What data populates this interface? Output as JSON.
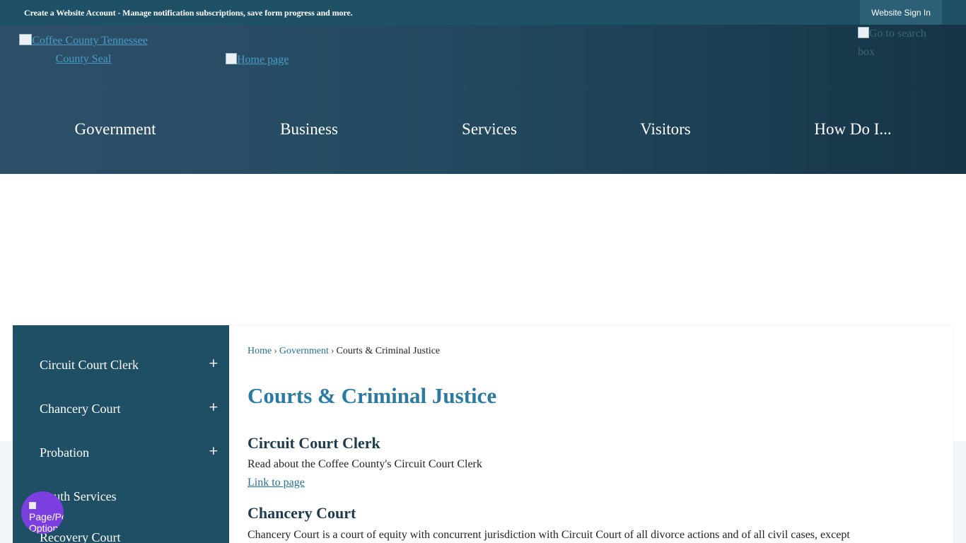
{
  "topbar": {
    "message_bold": "Create a Website Account",
    "message_rest": " - Manage notification subscriptions, save form progress and more.",
    "signin_label": "Website Sign In"
  },
  "header": {
    "seal_alt": "Coffee County Tennessee County Seal",
    "home_alt": "Home page",
    "search_alt": "Go to search box"
  },
  "nav": {
    "items": [
      "Government",
      "Business",
      "Services",
      "Visitors",
      "How Do I..."
    ]
  },
  "sidebar": {
    "items": [
      {
        "label": "Circuit Court Clerk",
        "expand": "+"
      },
      {
        "label": "Chancery Court",
        "expand": "+"
      },
      {
        "label": "Probation",
        "expand": "+"
      },
      {
        "label": "Youth Services",
        "expand": ""
      },
      {
        "label": "Recovery Court",
        "expand": ""
      }
    ]
  },
  "breadcrumb": {
    "home": "Home",
    "government": "Government",
    "current": "Courts & Criminal Justice",
    "sep": "›"
  },
  "main": {
    "title": "Courts & Criminal Justice",
    "sections": [
      {
        "heading": "Circuit Court Clerk",
        "text": "Read about the Coffee County's Circuit Court Clerk",
        "link": "Link to page"
      },
      {
        "heading": "Chancery Court",
        "text": "Chancery Court is a court of equity with concurrent jurisdiction with Circuit Court of all divorce actions and of all civil cases, except"
      }
    ]
  },
  "fab": {
    "alt": "Page/Personalization Options"
  },
  "colors": {
    "topbar": "#1e5066",
    "header_start": "#2d5069",
    "header_end": "#163547",
    "sidebar": "#1e4f65",
    "title": "#2a7aa1",
    "link": "#23729a",
    "fab": "#7b3fe0"
  }
}
